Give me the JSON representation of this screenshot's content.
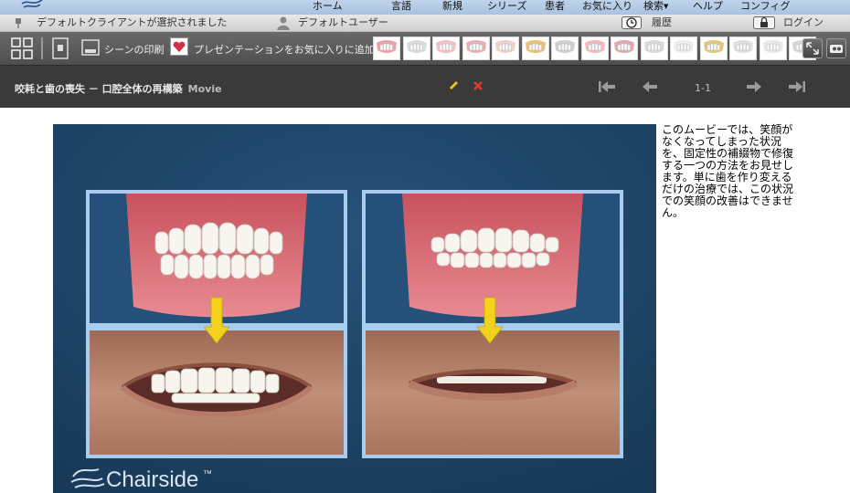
{
  "topnav": {
    "items": [
      {
        "label": "ホーム",
        "dropdown": false
      },
      {
        "label": "言語",
        "dropdown": false
      },
      {
        "label": "新規",
        "dropdown": false
      },
      {
        "label": "シリーズ",
        "dropdown": false
      },
      {
        "label": "患者",
        "dropdown": false
      },
      {
        "label": "お気に入り",
        "dropdown": false
      },
      {
        "label": "検索",
        "dropdown": true
      },
      {
        "label": "ヘルプ",
        "dropdown": false
      },
      {
        "label": "コンフィグ",
        "dropdown": false
      }
    ]
  },
  "statusbar": {
    "client_status": "デフォルトクライアントが選択されました",
    "user": "デフォルトユーザー",
    "history_label": "履歴",
    "login_label": "ログイン"
  },
  "toolbar": {
    "print_scene_label": "シーンの印刷",
    "add_favorite_label": "プレゼンテーションをお気に入りに追加",
    "thumbnail_count": 15
  },
  "info": {
    "title": "咬耗と歯の喪失 － 口腔全体の再構築",
    "media_type": "Movie",
    "page": "1-1"
  },
  "video": {
    "brand": "Chairside",
    "trademark": "™"
  },
  "description": "このムービーでは、笑顔がなくなってしまった状況を、固定性の補綴物で修復する一つの方法をお見せします。単に歯を作り変えるだけの治療では、この状況での笑顔の改善はできません。",
  "colors": {
    "video_bg": "#1d4061",
    "frame_border": "#a9cdef",
    "arrow": "#f2d21c",
    "toolbar_bg": "#555555",
    "infobar_bg": "#3a3a3a"
  }
}
